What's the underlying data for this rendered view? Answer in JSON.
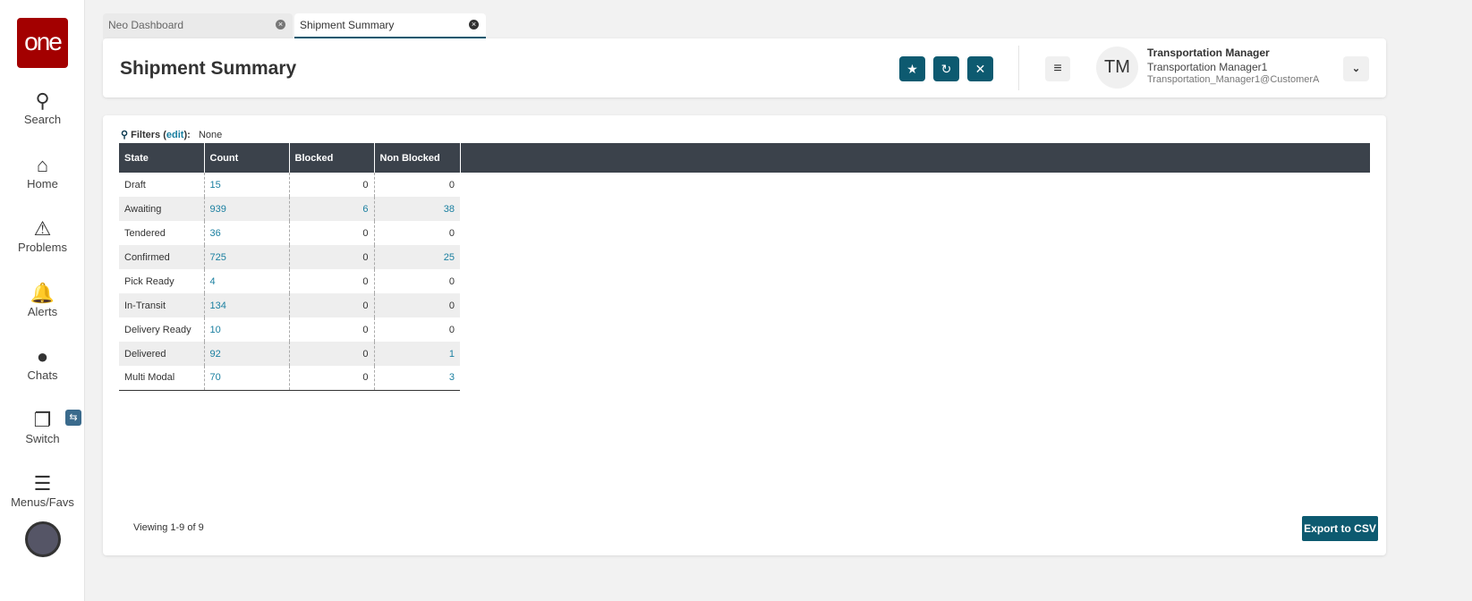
{
  "sidebar": {
    "logo": "one",
    "items": [
      {
        "label": "Search",
        "icon": "search-icon"
      },
      {
        "label": "Home",
        "icon": "home-icon"
      },
      {
        "label": "Problems",
        "icon": "warning-icon"
      },
      {
        "label": "Alerts",
        "icon": "bell-icon"
      },
      {
        "label": "Chats",
        "icon": "chat-icon"
      },
      {
        "label": "Switch",
        "icon": "switch-icon"
      },
      {
        "label": "Menus/Favs",
        "icon": "menu-icon"
      }
    ]
  },
  "tabs": [
    {
      "label": "Neo Dashboard"
    },
    {
      "label": "Shipment Summary"
    }
  ],
  "header": {
    "title": "Shipment Summary",
    "user": {
      "initials": "TM",
      "role": "Transportation Manager",
      "name": "Transportation Manager1",
      "account": "Transportation_Manager1@CustomerA"
    }
  },
  "filters": {
    "label": "Filters",
    "edit": "edit",
    "value": "None"
  },
  "table": {
    "columns": [
      "State",
      "Count",
      "Blocked",
      "Non Blocked"
    ],
    "rows": [
      [
        "Draft",
        "15",
        "0",
        "0"
      ],
      [
        "Awaiting",
        "939",
        "6",
        "38"
      ],
      [
        "Tendered",
        "36",
        "0",
        "0"
      ],
      [
        "Confirmed",
        "725",
        "0",
        "25"
      ],
      [
        "Pick Ready",
        "4",
        "0",
        "0"
      ],
      [
        "In-Transit",
        "134",
        "0",
        "0"
      ],
      [
        "Delivery Ready",
        "10",
        "0",
        "0"
      ],
      [
        "Delivered",
        "92",
        "0",
        "1"
      ],
      [
        "Multi Modal",
        "70",
        "0",
        "3"
      ]
    ]
  },
  "footer": {
    "viewing": "Viewing 1-9 of 9",
    "export": "Export to CSV"
  }
}
